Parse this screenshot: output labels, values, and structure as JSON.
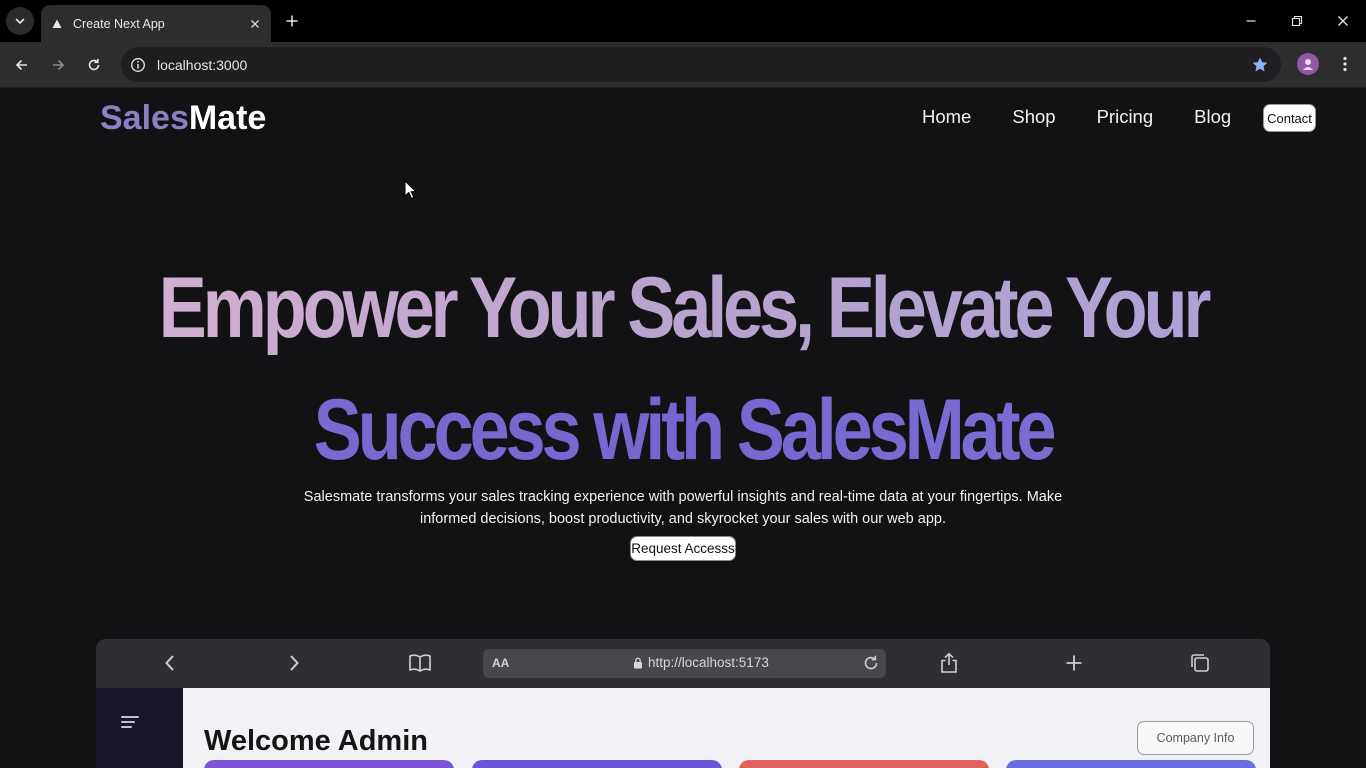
{
  "browser": {
    "tab_title": "Create Next App",
    "url": "localhost:3000"
  },
  "site": {
    "logo_part1": "Sales",
    "logo_part2": "Mate",
    "nav": {
      "home": "Home",
      "shop": "Shop",
      "pricing": "Pricing",
      "blog": "Blog",
      "contact": "Contact"
    },
    "hero": {
      "line1": "Empower Your Sales, Elevate Your",
      "line2": "Success with SalesMate",
      "description": "Salesmate transforms your sales tracking experience with powerful insights and real-time data at your fingertips. Make informed decisions, boost productivity, and skyrocket your sales with our web app.",
      "cta": "Request Accesss"
    },
    "preview": {
      "aa": "AA",
      "url": "http://localhost:5173",
      "welcome": "Welcome Admin",
      "company_info": "Company Info"
    }
  },
  "colors": {
    "logo_accent": "#8b80c4",
    "hero_line1": "#c2aad0",
    "hero_line2": "#7768d1",
    "card_colors": [
      "#7b55d8",
      "#6a57d6",
      "#e0625f",
      "#6a6fe0"
    ]
  }
}
